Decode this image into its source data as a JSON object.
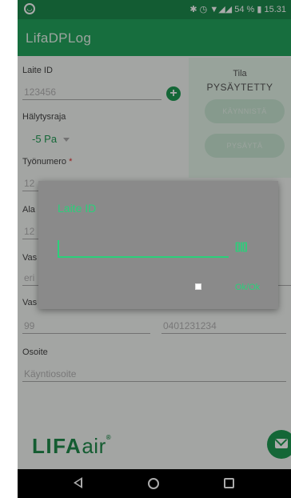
{
  "status_bar": {
    "indicators": "✱ ◷ ▼◢◢",
    "battery": "54 %",
    "time": "15.31"
  },
  "app_bar": {
    "title": "LifaDPLog"
  },
  "form": {
    "device_id": {
      "label": "Laite ID",
      "value": "123456"
    },
    "status": {
      "label": "Tila",
      "value": "PYSÄYTETTY",
      "start_label": "KÄYNNISTÄ",
      "stop_label": "PYSÄYTÄ"
    },
    "alarm_limit": {
      "label": "Hälytysraja",
      "value": "-5 Pa"
    },
    "work_number": {
      "label": "Työnumero",
      "required_mark": "*",
      "value": "12"
    },
    "field5": {
      "label": "Ala",
      "value": "12"
    },
    "field6": {
      "label": "Vas",
      "value": "eri"
    },
    "field7": {
      "label": "Vas",
      "value": "99",
      "value2": "0401231234"
    },
    "address": {
      "label": "Osoite",
      "placeholder": "Käyntiosoite"
    }
  },
  "brand": {
    "name": "LIFA",
    "suffix": "air",
    "mark": "®"
  },
  "dialog": {
    "title": "Laite ID",
    "input_value": "",
    "scan_label": "[|||]",
    "ok_label": "Ok/Ok"
  },
  "icons": {
    "add": "plus-circle-icon",
    "mail": "envelope-icon",
    "back": "back-triangle-icon",
    "home": "home-circle-icon",
    "recent": "recent-square-icon"
  },
  "colors": {
    "primary": "#23a55d",
    "status_bar": "#1d8a4c",
    "accent": "#2ad07a",
    "brand": "#1e8a4a"
  }
}
